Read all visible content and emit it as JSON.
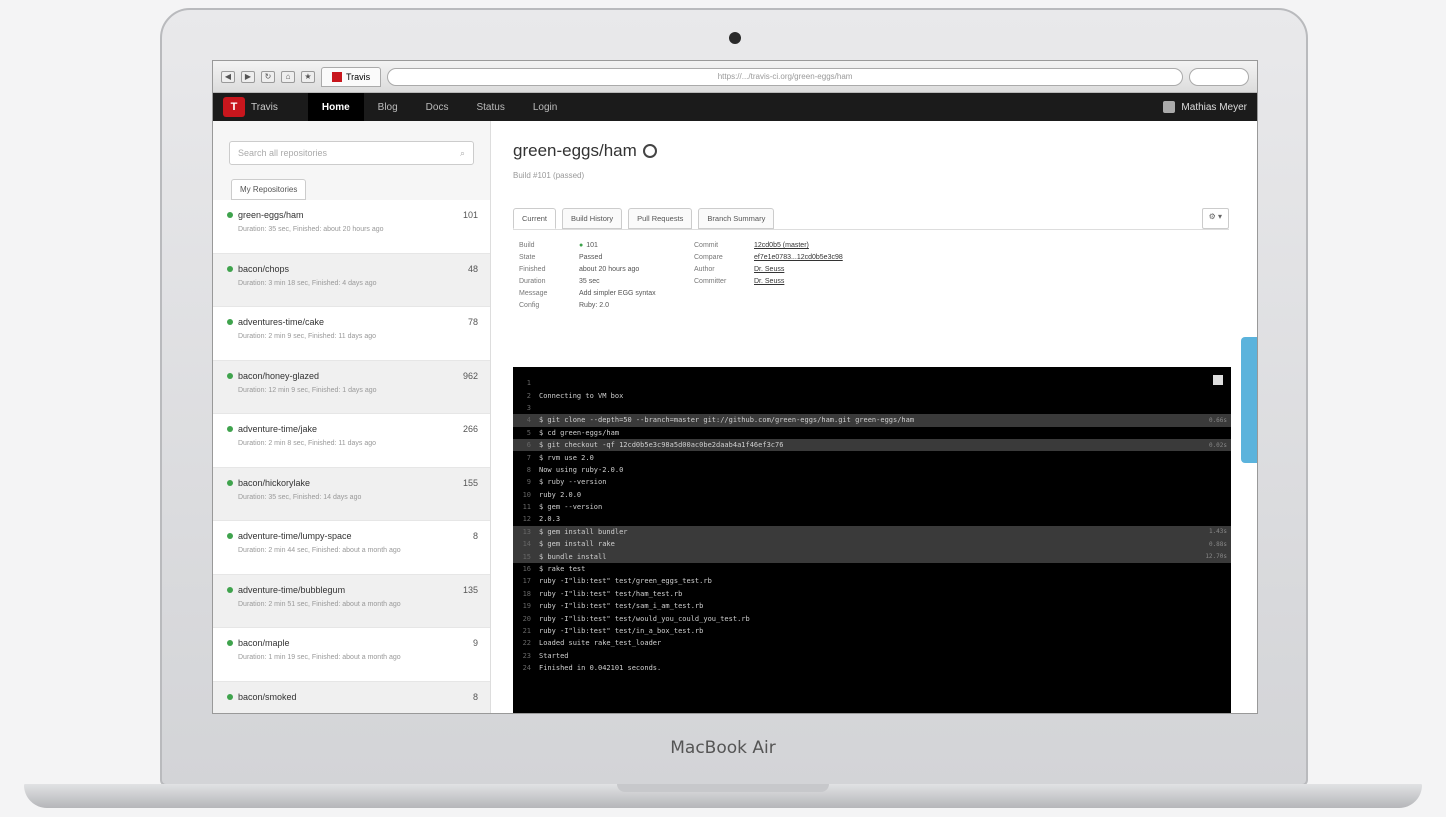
{
  "device": {
    "label": "MacBook Air"
  },
  "browser": {
    "tab_title": "Travis",
    "url": "https://.../travis-ci.org/green-eggs/ham"
  },
  "app": {
    "brand": "Travis",
    "nav": [
      "Home",
      "Blog",
      "Docs",
      "Status",
      "Login"
    ],
    "user": "Mathias Meyer"
  },
  "sidebar": {
    "search_placeholder": "Search all repositories",
    "tab": "My Repositories",
    "repos": [
      {
        "name": "green-eggs/ham",
        "num": "101",
        "meta": "Duration: 35 sec, Finished: about 20 hours ago"
      },
      {
        "name": "bacon/chops",
        "num": "48",
        "meta": "Duration: 3 min 18 sec, Finished: 4 days ago"
      },
      {
        "name": "adventures-time/cake",
        "num": "78",
        "meta": "Duration: 2 min 9 sec, Finished: 11 days ago"
      },
      {
        "name": "bacon/honey-glazed",
        "num": "962",
        "meta": "Duration: 12 min 9 sec, Finished: 1 days ago"
      },
      {
        "name": "adventure-time/jake",
        "num": "266",
        "meta": "Duration: 2 min 8 sec, Finished: 11 days ago"
      },
      {
        "name": "bacon/hickorylake",
        "num": "155",
        "meta": "Duration: 35 sec, Finished: 14 days ago"
      },
      {
        "name": "adventure-time/lumpy-space",
        "num": "8",
        "meta": "Duration: 2 min 44 sec, Finished: about a month ago"
      },
      {
        "name": "adventure-time/bubblegum",
        "num": "135",
        "meta": "Duration: 2 min 51 sec, Finished: about a month ago"
      },
      {
        "name": "bacon/maple",
        "num": "9",
        "meta": "Duration: 1 min 19 sec, Finished: about a month ago"
      },
      {
        "name": "bacon/smoked",
        "num": "8",
        "meta": ""
      }
    ]
  },
  "repo": {
    "title": "green-eggs/ham",
    "subtitle": "Build #101 (passed)",
    "tabs": [
      "Current",
      "Build History",
      "Pull Requests",
      "Branch Summary"
    ],
    "tools_label": "⚙ ▾",
    "summary": [
      {
        "k1": "Build",
        "v1": "101",
        "k2": "Commit",
        "v2": "12cd0b5 (master)"
      },
      {
        "k1": "State",
        "v1": "Passed",
        "k2": "Compare",
        "v2": "ef7e1e0783...12cd0b5e3c98"
      },
      {
        "k1": "Finished",
        "v1": "about 20 hours ago",
        "k2": "Author",
        "v2": "Dr. Seuss"
      },
      {
        "k1": "Duration",
        "v1": "35 sec",
        "k2": "Committer",
        "v2": "Dr. Seuss"
      },
      {
        "k1": "Message",
        "v1": "Add simpler EGG syntax",
        "k2": "",
        "v2": ""
      },
      {
        "k1": "Config",
        "v1": "Ruby: 2.0",
        "k2": "",
        "v2": ""
      }
    ]
  },
  "terminal": {
    "lines": [
      {
        "n": "1",
        "text": "",
        "t": "",
        "hl": false
      },
      {
        "n": "2",
        "text": "Connecting to VM box",
        "t": "",
        "hl": false
      },
      {
        "n": "3",
        "text": "",
        "t": "",
        "hl": false
      },
      {
        "n": "4",
        "text": "$ git clone --depth=50 --branch=master git://github.com/green-eggs/ham.git green-eggs/ham",
        "t": "0.66s",
        "hl": true
      },
      {
        "n": "5",
        "text": "$ cd green-eggs/ham",
        "t": "",
        "hl": false
      },
      {
        "n": "6",
        "text": "$ git checkout -qf 12cd0b5e3c98a5d00ac0be2daab4a1f46ef3c76",
        "t": "0.02s",
        "hl": true
      },
      {
        "n": "7",
        "text": "$ rvm use 2.0",
        "t": "",
        "hl": false
      },
      {
        "n": "8",
        "text": "Now using ruby-2.0.0",
        "t": "",
        "hl": false
      },
      {
        "n": "9",
        "text": "$ ruby --version",
        "t": "",
        "hl": false
      },
      {
        "n": "10",
        "text": "ruby 2.0.0",
        "t": "",
        "hl": false
      },
      {
        "n": "11",
        "text": "$ gem --version",
        "t": "",
        "hl": false
      },
      {
        "n": "12",
        "text": "2.0.3",
        "t": "",
        "hl": false
      },
      {
        "n": "13",
        "text": "$ gem install bundler",
        "t": "1.43s",
        "hl": true
      },
      {
        "n": "14",
        "text": "$ gem install rake",
        "t": "0.88s",
        "hl": true
      },
      {
        "n": "15",
        "text": "$ bundle install",
        "t": "12.70s",
        "hl": true
      },
      {
        "n": "16",
        "text": "$ rake test",
        "t": "",
        "hl": false
      },
      {
        "n": "17",
        "text": "ruby -I\"lib:test\" test/green_eggs_test.rb",
        "t": "",
        "hl": false
      },
      {
        "n": "18",
        "text": "ruby -I\"lib:test\" test/ham_test.rb",
        "t": "",
        "hl": false
      },
      {
        "n": "19",
        "text": "ruby -I\"lib:test\" test/sam_i_am_test.rb",
        "t": "",
        "hl": false
      },
      {
        "n": "20",
        "text": "ruby -I\"lib:test\" test/would_you_could_you_test.rb",
        "t": "",
        "hl": false
      },
      {
        "n": "21",
        "text": "ruby -I\"lib:test\" test/in_a_box_test.rb",
        "t": "",
        "hl": false
      },
      {
        "n": "22",
        "text": "Loaded suite rake_test_loader",
        "t": "",
        "hl": false
      },
      {
        "n": "23",
        "text": "Started",
        "t": "",
        "hl": false
      },
      {
        "n": "24",
        "text": "Finished in 0.042101 seconds.",
        "t": "",
        "hl": false
      }
    ]
  }
}
